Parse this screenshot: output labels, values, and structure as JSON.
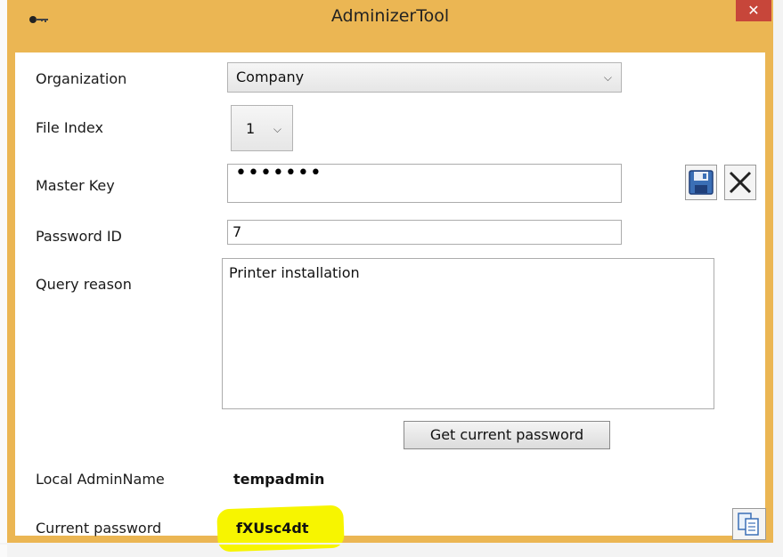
{
  "window": {
    "title": "AdminizerTool",
    "close_label": "✕",
    "accent_color": "#ebb653",
    "close_color": "#c7463a"
  },
  "form": {
    "organization": {
      "label": "Organization",
      "value": "Company"
    },
    "file_index": {
      "label": "File Index",
      "value": "1"
    },
    "master_key": {
      "label": "Master Key",
      "masked_value": "•••••••"
    },
    "password_id": {
      "label": "Password ID",
      "value": "7"
    },
    "query_reason": {
      "label": "Query reason",
      "value": "Printer installation"
    },
    "get_password_button": "Get current password",
    "local_admin": {
      "label": "Local AdminName",
      "value": "tempadmin"
    },
    "current_password": {
      "label": "Current password",
      "value": "fXUsc4dt",
      "highlight_color": "#f7f500"
    }
  },
  "icons": {
    "app": "key-icon",
    "save": "floppy-disk-icon",
    "clear": "close-icon",
    "copy": "copy-icon"
  }
}
